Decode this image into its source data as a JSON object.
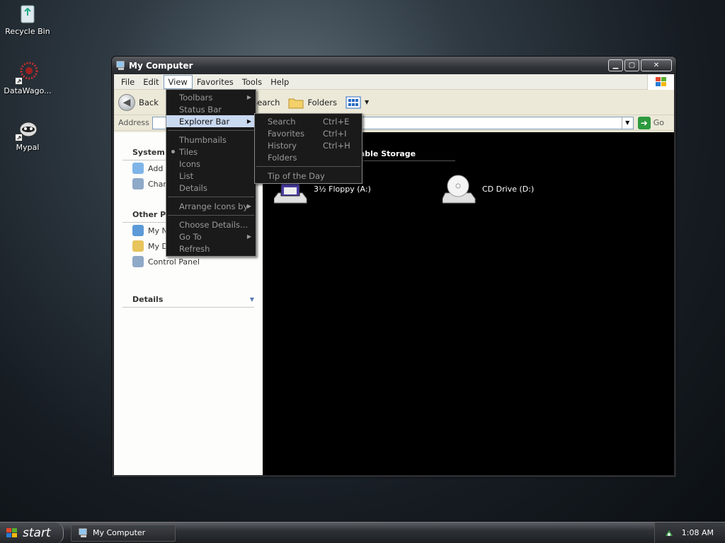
{
  "desktop": {
    "icons": [
      {
        "label": "Recycle Bin",
        "icon": "recycle-bin-icon"
      },
      {
        "label": "DataWago...",
        "icon": "datawagon-icon"
      },
      {
        "label": "Mypal",
        "icon": "mypal-icon"
      }
    ]
  },
  "window": {
    "title": "My Computer",
    "menu": [
      "File",
      "Edit",
      "View",
      "Favorites",
      "Tools",
      "Help"
    ],
    "toolbar": {
      "back": "Back",
      "search": "Search",
      "folders": "Folders"
    },
    "address": {
      "label": "Address",
      "value": "",
      "go": "Go"
    },
    "taskpane": {
      "system_tasks": {
        "title": "System T",
        "items": [
          "Add",
          "Chan"
        ]
      },
      "other_places": {
        "title": "Other Pla",
        "items": [
          "My N",
          "My D",
          "Control Panel"
        ]
      },
      "details": {
        "title": "Details"
      }
    },
    "content": {
      "group_title": "Devices with Removable Storage",
      "drives": [
        {
          "label": "3½ Floppy (A:)",
          "icon": "floppy-drive-icon"
        },
        {
          "label": "CD Drive (D:)",
          "icon": "cd-drive-icon"
        }
      ]
    }
  },
  "view_menu": {
    "toolbars": "Toolbars",
    "status_bar": "Status Bar",
    "explorer_bar": "Explorer Bar",
    "thumbnails": "Thumbnails",
    "tiles": "Tiles",
    "icons": "Icons",
    "list": "List",
    "details": "Details",
    "arrange_icons_by": "Arrange Icons by",
    "choose_details": "Choose Details...",
    "go_to": "Go To",
    "refresh": "Refresh"
  },
  "explorer_bar_menu": {
    "search": {
      "label": "Search",
      "shortcut": "Ctrl+E"
    },
    "favorites": {
      "label": "Favorites",
      "shortcut": "Ctrl+I"
    },
    "history": {
      "label": "History",
      "shortcut": "Ctrl+H"
    },
    "folders": {
      "label": "Folders"
    },
    "tip": {
      "label": "Tip of the Day"
    }
  },
  "taskbar": {
    "start": "start",
    "task": "My Computer",
    "clock": "1:08 AM"
  },
  "colors": {
    "highlight": "#c9d9f0",
    "menu_bg": "#1a1a1a",
    "content_bg": "#000000"
  }
}
